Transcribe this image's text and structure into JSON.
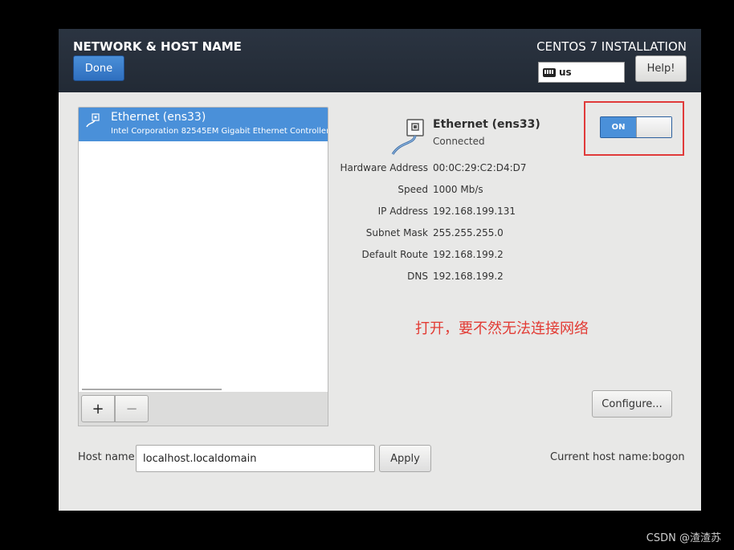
{
  "header": {
    "title": "NETWORK & HOST NAME",
    "done_label": "Done",
    "install_title": "CENTOS 7 INSTALLATION",
    "keyboard_layout": "us",
    "help_label": "Help!"
  },
  "device_list": {
    "items": [
      {
        "name": "Ethernet (ens33)",
        "description": "Intel Corporation 82545EM Gigabit Ethernet Controller ("
      }
    ],
    "add_label": "+",
    "remove_label": "−"
  },
  "device_detail": {
    "name": "Ethernet (ens33)",
    "status": "Connected",
    "switch_label": "ON",
    "properties": [
      {
        "label": "Hardware Address",
        "value": "00:0C:29:C2:D4:D7"
      },
      {
        "label": "Speed",
        "value": "1000 Mb/s"
      },
      {
        "label": "IP Address",
        "value": "192.168.199.131"
      },
      {
        "label": "Subnet Mask",
        "value": "255.255.255.0"
      },
      {
        "label": "Default Route",
        "value": "192.168.199.2"
      },
      {
        "label": "DNS",
        "value": "192.168.199.2"
      }
    ],
    "configure_label": "Configure..."
  },
  "annotation": "打开，要不然无法连接网络",
  "hostname": {
    "label": "Host name:",
    "value": "localhost.localdomain",
    "apply_label": "Apply",
    "current_label": "Current host name:",
    "current_value": "bogon"
  },
  "watermark": "CSDN @渣渣苏",
  "colors": {
    "accent": "#4a90d9",
    "annotation": "#e23b34",
    "header": "#262e3a"
  }
}
